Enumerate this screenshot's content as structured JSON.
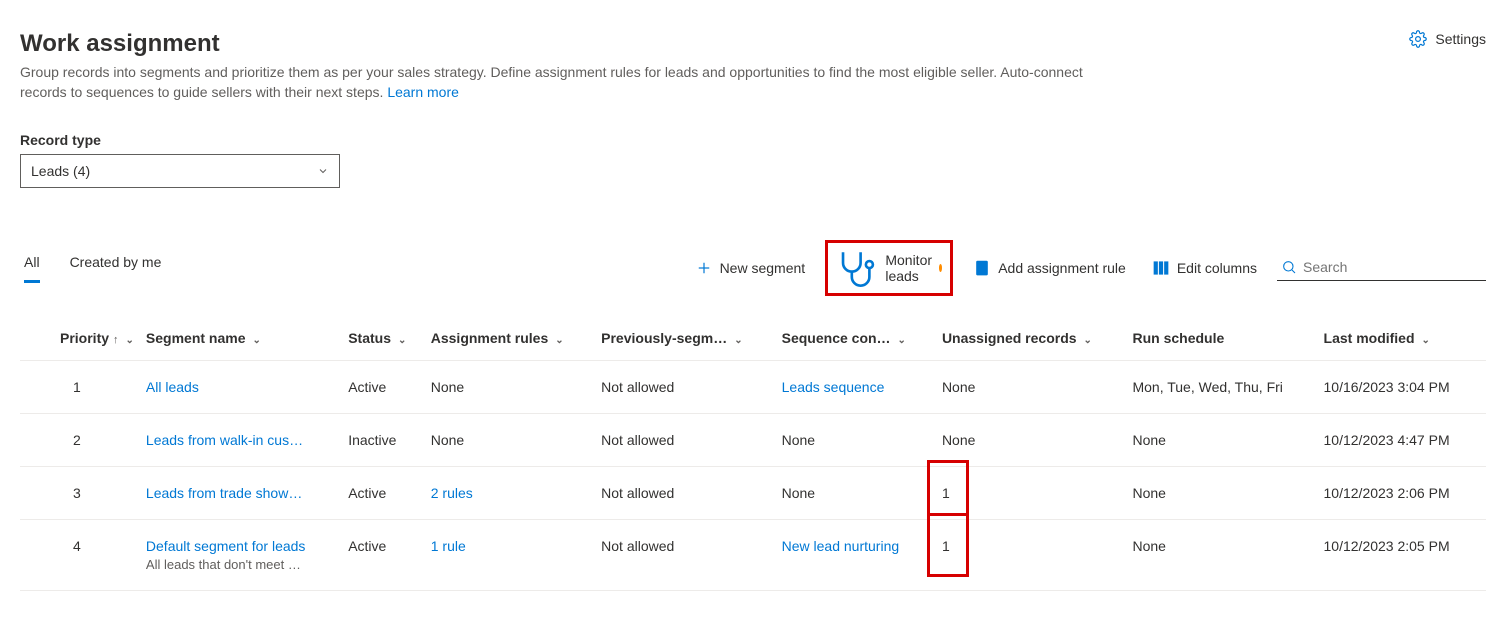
{
  "page": {
    "title": "Work assignment",
    "description": "Group records into segments and prioritize them as per your sales strategy. Define assignment rules for leads and opportunities to find the most eligible seller. Auto-connect records to sequences to guide sellers with their next steps. ",
    "learn_more": "Learn more"
  },
  "settings_label": "Settings",
  "record_type": {
    "label": "Record type",
    "value": "Leads (4)"
  },
  "tabs": {
    "all": "All",
    "created_by_me": "Created by me"
  },
  "commands": {
    "new_segment": "New segment",
    "monitor_leads": "Monitor leads",
    "add_assignment_rule": "Add assignment rule",
    "edit_columns": "Edit columns"
  },
  "search": {
    "placeholder": "Search"
  },
  "columns": {
    "priority": "Priority",
    "segment_name": "Segment name",
    "status": "Status",
    "assignment_rules": "Assignment rules",
    "previously_segmented": "Previously-segm…",
    "sequence_connected": "Sequence con…",
    "unassigned_records": "Unassigned records",
    "run_schedule": "Run schedule",
    "last_modified": "Last modified"
  },
  "rows": [
    {
      "priority": "1",
      "name": "All leads",
      "subtitle": "",
      "status": "Active",
      "rules": "None",
      "rules_link": false,
      "prev": "Not allowed",
      "sequence": "Leads sequence",
      "sequence_link": true,
      "unassigned": "None",
      "unassigned_flag": false,
      "schedule": "Mon, Tue, Wed, Thu, Fri",
      "modified": "10/16/2023 3:04 PM"
    },
    {
      "priority": "2",
      "name": "Leads from walk-in custo…",
      "subtitle": "",
      "status": "Inactive",
      "rules": "None",
      "rules_link": false,
      "prev": "Not allowed",
      "sequence": "None",
      "sequence_link": false,
      "unassigned": "None",
      "unassigned_flag": false,
      "schedule": "None",
      "modified": "10/12/2023 4:47 PM"
    },
    {
      "priority": "3",
      "name": "Leads from trade shows …",
      "subtitle": "",
      "status": "Active",
      "rules": "2 rules",
      "rules_link": true,
      "prev": "Not allowed",
      "sequence": "None",
      "sequence_link": false,
      "unassigned": "1",
      "unassigned_flag": true,
      "schedule": "None",
      "modified": "10/12/2023 2:06 PM"
    },
    {
      "priority": "4",
      "name": "Default segment for leads",
      "subtitle": "All leads that don't meet oth…",
      "status": "Active",
      "rules": "1 rule",
      "rules_link": true,
      "prev": "Not allowed",
      "sequence": "New lead nurturing",
      "sequence_link": true,
      "unassigned": "1",
      "unassigned_flag": true,
      "schedule": "None",
      "modified": "10/12/2023 2:05 PM"
    }
  ]
}
